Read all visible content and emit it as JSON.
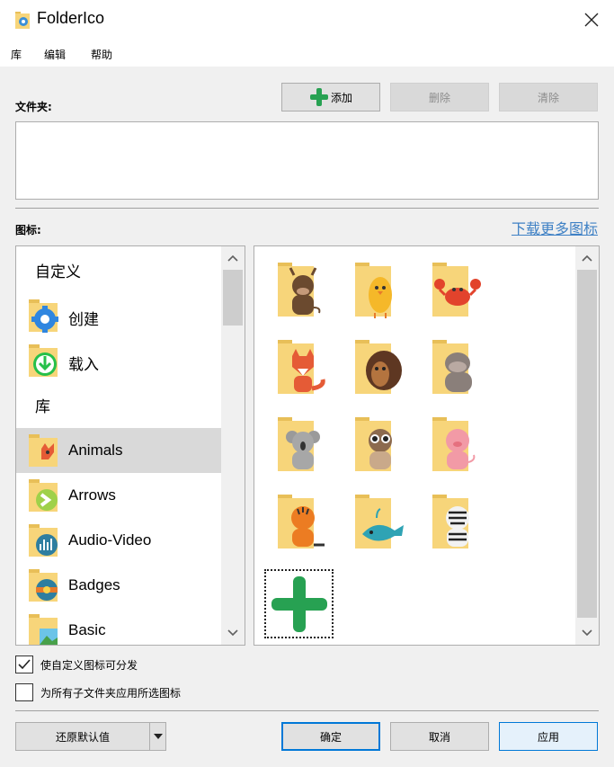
{
  "window": {
    "title": "FolderIco"
  },
  "menu": [
    "库",
    "编辑",
    "帮助"
  ],
  "folders": {
    "label": "文件夹:",
    "add_label": "添加",
    "delete_label": "删除",
    "clear_label": "清除"
  },
  "icons_section": {
    "label": "图标:",
    "download_link": "下载更多图标"
  },
  "left_list": {
    "custom_header": "自定义",
    "create_label": "创建",
    "load_label": "载入",
    "library_header": "库",
    "libraries": [
      {
        "label": "Animals",
        "selected": true
      },
      {
        "label": "Arrows",
        "selected": false
      },
      {
        "label": "Audio-Video",
        "selected": false
      },
      {
        "label": "Badges",
        "selected": false
      },
      {
        "label": "Basic",
        "selected": false
      }
    ]
  },
  "icon_grid": [
    {
      "name": "bull"
    },
    {
      "name": "chick"
    },
    {
      "name": "crab"
    },
    {
      "name": "fox"
    },
    {
      "name": "hedgehog"
    },
    {
      "name": "hippo"
    },
    {
      "name": "koala"
    },
    {
      "name": "lemur"
    },
    {
      "name": "pig"
    },
    {
      "name": "tiger"
    },
    {
      "name": "whale"
    },
    {
      "name": "zebra"
    }
  ],
  "options": {
    "distributable_label": "使自定义图标可分发",
    "distributable_checked": true,
    "apply_subfolders_label": "为所有子文件夹应用所选图标",
    "apply_subfolders_checked": false
  },
  "footer": {
    "restore_label": "还原默认值",
    "ok_label": "确定",
    "cancel_label": "取消",
    "apply_label": "应用"
  },
  "colors": {
    "folder": "#f7d57a",
    "folder_tab": "#e8bf58",
    "green_plus": "#27a152",
    "link": "#3f81c5",
    "focus": "#0078d7"
  }
}
